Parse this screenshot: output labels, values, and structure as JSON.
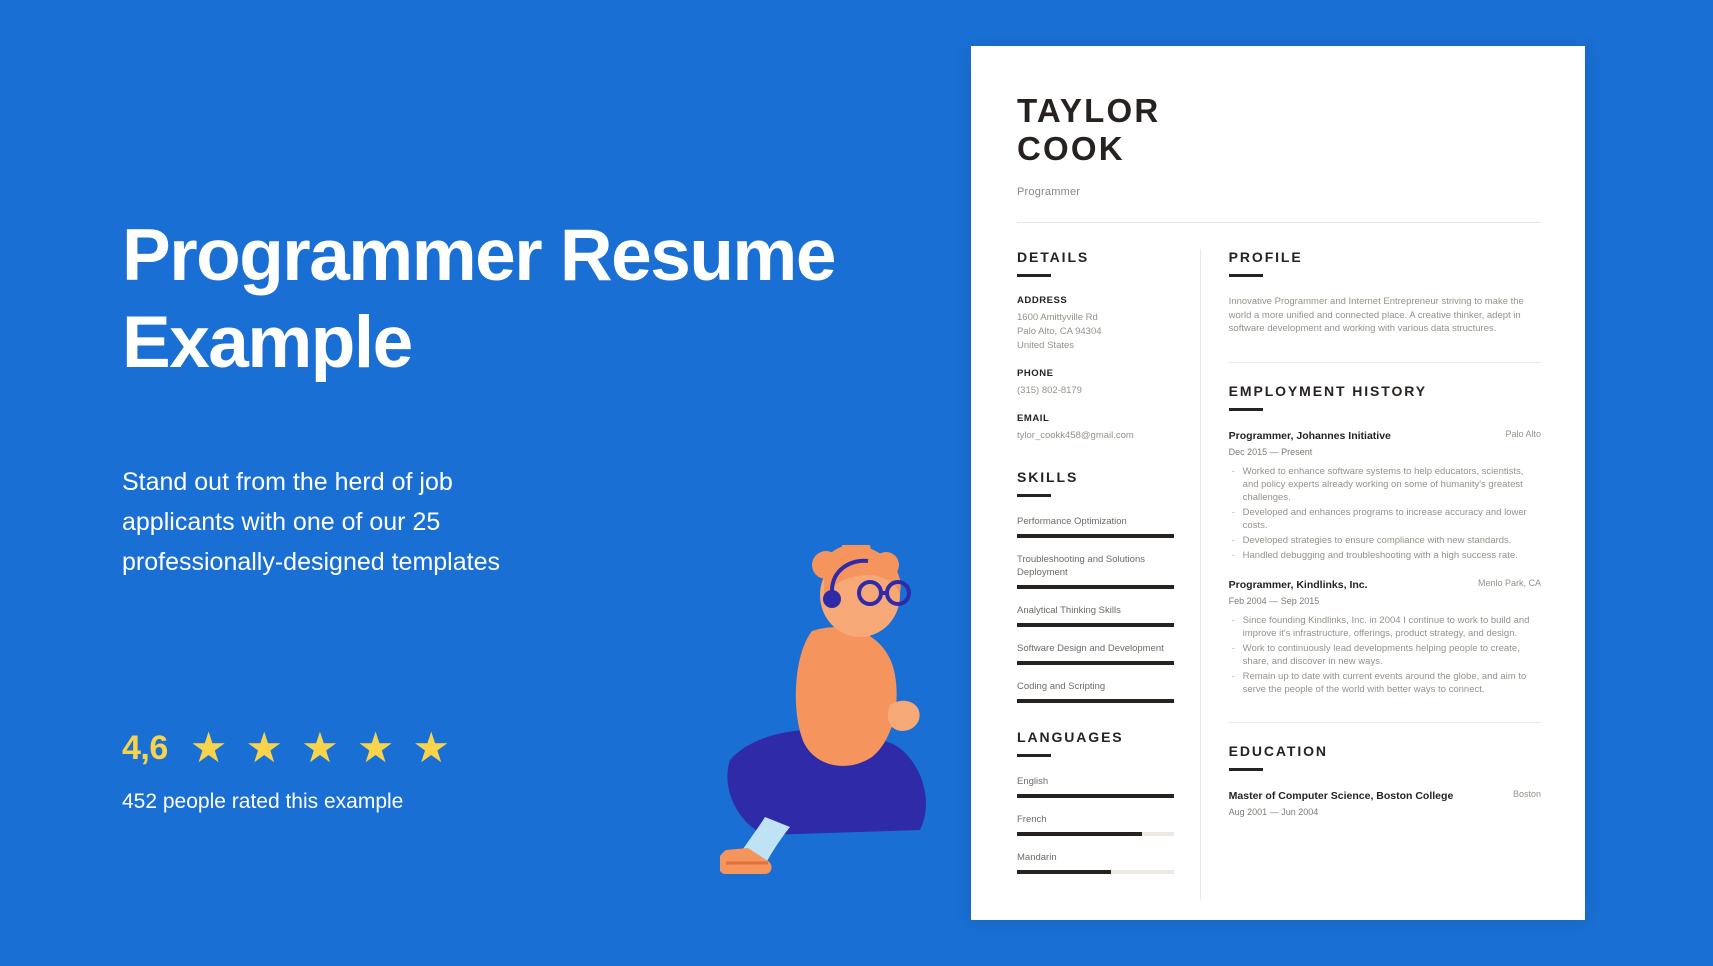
{
  "promo": {
    "headline": "Programmer Resume Example",
    "subtext": "Stand out from the herd of job applicants with one of our 25 professionally-designed templates",
    "rating_score": "4,6",
    "stars": [
      "star",
      "star",
      "star",
      "star",
      "star"
    ],
    "rating_caption": "452 people rated this example",
    "background_color": "#1a6fd4",
    "star_color": "#f7d44c"
  },
  "resume": {
    "name_line1": "TAYLOR",
    "name_line2": "COOK",
    "job_title": "Programmer",
    "details": {
      "heading": "DETAILS",
      "address_label": "ADDRESS",
      "address_lines": "1600 Amittyville Rd\nPalo Alto, CA 94304\nUnited States",
      "phone_label": "PHONE",
      "phone_value": "(315) 802-8179",
      "email_label": "EMAIL",
      "email_value": "tylor_cookk458@gmail.com"
    },
    "skills": {
      "heading": "SKILLS",
      "items": [
        {
          "label": "Performance Optimization",
          "level": 100
        },
        {
          "label": "Troubleshooting and Solutions Deployment",
          "level": 100
        },
        {
          "label": "Analytical Thinking Skills",
          "level": 100
        },
        {
          "label": "Software Design and Development",
          "level": 100
        },
        {
          "label": "Coding and Scripting",
          "level": 100
        }
      ]
    },
    "languages": {
      "heading": "LANGUAGES",
      "items": [
        {
          "label": "English",
          "level": 100
        },
        {
          "label": "French",
          "level": 80
        },
        {
          "label": "Mandarin",
          "level": 60
        }
      ]
    },
    "profile": {
      "heading": "PROFILE",
      "text": "Innovative Programmer and Internet Entrepreneur striving to make the world a more unified and connected place. A creative thinker, adept in software development and working with various data structures."
    },
    "employment": {
      "heading": "EMPLOYMENT HISTORY",
      "jobs": [
        {
          "title": "Programmer, Johannes Initiative",
          "location": "Palo Alto",
          "dates": "Dec 2015 — Present",
          "bullets": [
            "Worked to enhance software systems to help educators, scientists, and policy experts already working on some of humanity's greatest challenges.",
            "Developed and enhances programs to increase accuracy and lower costs.",
            "Developed strategies to ensure compliance with new standards.",
            "Handled debugging and troubleshooting with a high success rate."
          ]
        },
        {
          "title": "Programmer, Kindlinks, Inc.",
          "location": "Menlo Park, CA",
          "dates": "Feb 2004 — Sep 2015",
          "bullets": [
            "Since founding Kindlinks, Inc. in 2004 I continue to work to build and improve it's infrastructure, offerings, product strategy, and design.",
            "Work to continuously lead developments helping people to create, share, and discover in new ways.",
            "Remain up to date with current events around the globe, and aim to serve the people of the world with better ways to connect."
          ]
        }
      ]
    },
    "education": {
      "heading": "EDUCATION",
      "entries": [
        {
          "title": "Master of Computer Science, Boston College",
          "location": "Boston",
          "dates": "Aug 2001 — Jun 2004"
        }
      ]
    }
  }
}
